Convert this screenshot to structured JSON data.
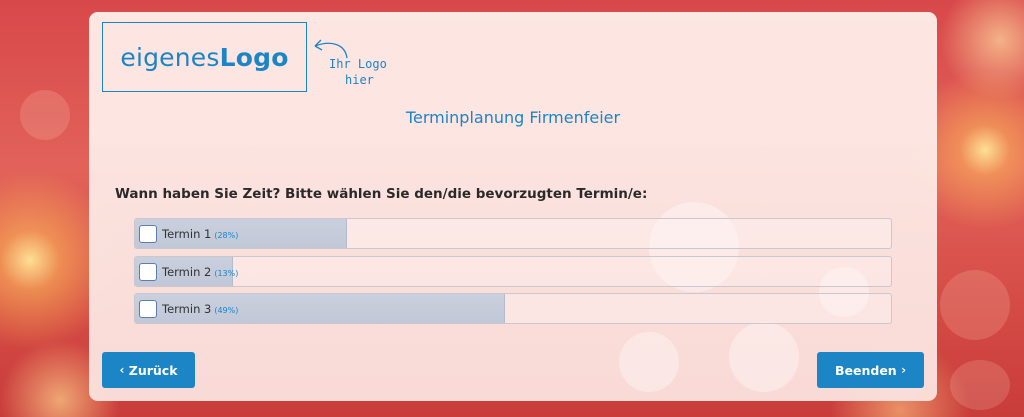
{
  "logo": {
    "text_regular": "eigenes",
    "text_bold": "Logo",
    "hint_line1": "Ihr Logo",
    "hint_line2": "hier"
  },
  "survey": {
    "title": "Terminplanung Firmenfeier",
    "question": "Wann haben Sie Zeit? Bitte wählen Sie den/die bevorzugten Termin/e:",
    "options": [
      {
        "label": "Termin 1",
        "percent_label": "(28%)",
        "percent": 28,
        "checked": false
      },
      {
        "label": "Termin 2",
        "percent_label": "(13%)",
        "percent": 13,
        "checked": false
      },
      {
        "label": "Termin 3",
        "percent_label": "(49%)",
        "percent": 49,
        "checked": false
      }
    ]
  },
  "navigation": {
    "back_label": "Zurück",
    "back_icon": "‹",
    "finish_label": "Beenden",
    "finish_icon": "›"
  },
  "colors": {
    "accent": "#1b85c6",
    "bar_fill": "#c4cddc"
  }
}
